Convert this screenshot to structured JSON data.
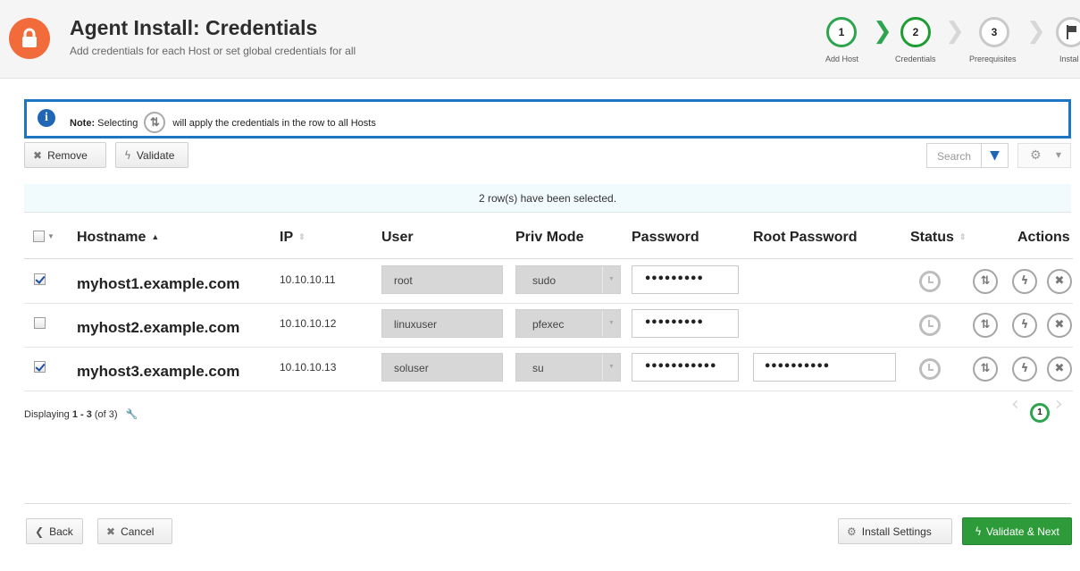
{
  "header": {
    "title": "Agent Install: Credentials",
    "subtitle": "Add credentials for each Host or set global credentials for all",
    "icon": "lock-icon",
    "icon_color": "#f26b3a"
  },
  "train": {
    "steps": [
      {
        "number": "1",
        "label": "Add Host",
        "state": "done"
      },
      {
        "number": "2",
        "label": "Credentials",
        "state": "current"
      },
      {
        "number": "3",
        "label": "Prerequisites",
        "state": "pending"
      },
      {
        "number": "",
        "label": "Instal",
        "state": "pending",
        "icon": "flag-icon"
      }
    ],
    "accent": "#2ea44f"
  },
  "note": {
    "label": "Note:",
    "text_before": "Selecting",
    "text_after": "will apply the credentials in the row to all Hosts",
    "icon": "info-icon"
  },
  "toolbar": {
    "remove_label": "Remove",
    "validate_label": "Validate",
    "search_placeholder": "Search",
    "filter_icon": "filter-icon",
    "settings_icon": "gear-icon"
  },
  "selection_banner": "2 row(s) have been selected.",
  "table": {
    "columns": {
      "hostname": "Hostname",
      "ip": "IP",
      "user": "User",
      "priv_mode": "Priv Mode",
      "password": "Password",
      "root_password": "Root Password",
      "status": "Status",
      "actions": "Actions"
    },
    "rows": [
      {
        "checked": true,
        "hostname": "myhost1.example.com",
        "ip": "10.10.10.11",
        "user": "root",
        "priv_mode": "sudo",
        "password": "•••••••••",
        "root_password": ""
      },
      {
        "checked": false,
        "hostname": "myhost2.example.com",
        "ip": "10.10.10.12",
        "user": "linuxuser",
        "priv_mode": "pfexec",
        "password": "•••••••••",
        "root_password": ""
      },
      {
        "checked": true,
        "hostname": "myhost3.example.com",
        "ip": "10.10.10.13",
        "user": "soluser",
        "priv_mode": "su",
        "password": "•••••••••••",
        "root_password": "••••••••••"
      }
    ]
  },
  "footer": {
    "displaying_prefix": "Displaying",
    "displaying_range": "1 - 3",
    "displaying_total": "(of 3)",
    "current_page": "1"
  },
  "buttons": {
    "back": "Back",
    "cancel": "Cancel",
    "install_settings": "Install Settings",
    "validate_next": "Validate & Next"
  }
}
